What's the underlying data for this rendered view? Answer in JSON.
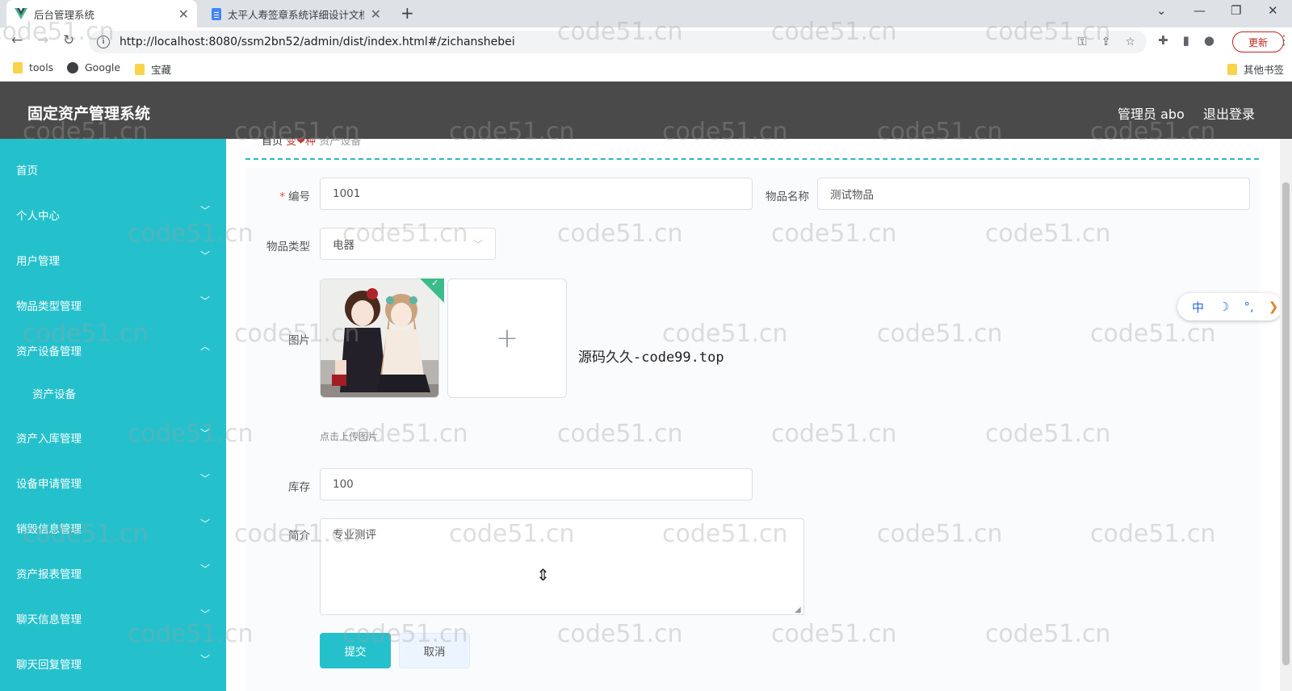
{
  "browser": {
    "tabs": [
      {
        "title": "后台管理系统",
        "active": true
      },
      {
        "title": "太平人寿签章系统详细设计文档",
        "active": false
      }
    ],
    "url": "http://localhost:8080/ssm2bn52/admin/dist/index.html#/zichanshebei",
    "update_label": "更新",
    "bookmarks": [
      "tools",
      "Google",
      "宝藏"
    ],
    "other_bookmarks": "其他书签"
  },
  "app": {
    "title": "固定资产管理系统",
    "user": "管理员 abo",
    "logout": "退出登录"
  },
  "sidebar": {
    "accent": "#24c1cc",
    "items": [
      {
        "label": "首页"
      },
      {
        "label": "个人中心"
      },
      {
        "label": "用户管理"
      },
      {
        "label": "物品类型管理"
      },
      {
        "label": "资产设备管理"
      },
      {
        "label": "资产设备"
      },
      {
        "label": "资产入库管理"
      },
      {
        "label": "设备申请管理"
      },
      {
        "label": "销毁信息管理"
      },
      {
        "label": "资产报表管理"
      },
      {
        "label": "聊天信息管理"
      },
      {
        "label": "聊天回复管理"
      }
    ]
  },
  "breadcrumb": {
    "home": "首页",
    "marker": "变❤种",
    "rest": "资产设备"
  },
  "form": {
    "code_label": "编号",
    "code_value": "1001",
    "name_label": "物品名称",
    "name_value": "测试物品",
    "type_label": "物品类型",
    "type_value": "电器",
    "image_label": "图片",
    "upload_hint": "点击上传图片",
    "stock_label": "库存",
    "stock_value": "100",
    "intro_label": "简介",
    "intro_value": "专业测评",
    "submit": "提交",
    "cancel": "取消"
  },
  "overlay_text": "源码久久-code99.top",
  "ime": {
    "lang": "中",
    "moon": "☽",
    "punct": "°,"
  },
  "watermark": "code51.cn"
}
